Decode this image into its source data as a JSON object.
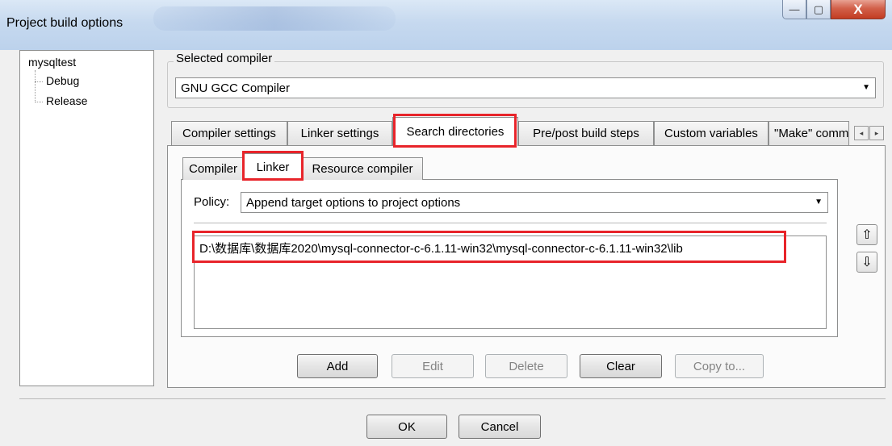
{
  "window": {
    "title": "Project build options",
    "minimize_glyph": "—",
    "maximize_glyph": "▢",
    "close_glyph": "X"
  },
  "tree": {
    "root": "mysqltest",
    "children": [
      "Debug",
      "Release"
    ]
  },
  "compiler": {
    "group_label": "Selected compiler",
    "selected": "GNU GCC Compiler"
  },
  "tabs": [
    "Compiler settings",
    "Linker settings",
    "Search directories",
    "Pre/post build steps",
    "Custom variables",
    "\"Make\" commands"
  ],
  "active_tab": "Search directories",
  "subtabs": [
    "Compiler",
    "Linker",
    "Resource compiler"
  ],
  "active_subtab": "Linker",
  "policy": {
    "label": "Policy:",
    "value": "Append target options to project options"
  },
  "directories": [
    "D:\\数据库\\数据库2020\\mysql-connector-c-6.1.11-win32\\mysql-connector-c-6.1.11-win32\\lib"
  ],
  "list_buttons": {
    "add": "Add",
    "edit": "Edit",
    "delete": "Delete",
    "clear": "Clear",
    "copy_to": "Copy to..."
  },
  "move_buttons": {
    "up": "⇧",
    "down": "⇩"
  },
  "tab_scroll": {
    "left": "◂",
    "right": "▸"
  },
  "dialog_buttons": {
    "ok": "OK",
    "cancel": "Cancel"
  },
  "annotation_color": "#e8242a"
}
